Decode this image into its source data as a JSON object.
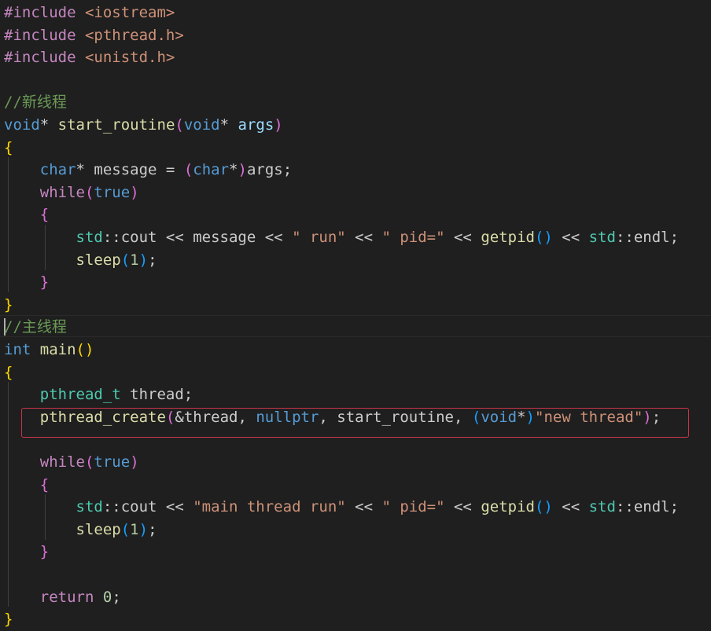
{
  "editor": {
    "language": "cpp",
    "colors": {
      "background": "#1f1f1f",
      "default": "#cccccc",
      "keyword": "#c586c0",
      "type": "#569cd6",
      "function": "#dcdcaa",
      "variable": "#9cdcfe",
      "namespace": "#4ec9b0",
      "string": "#ce9178",
      "number": "#b5cea8",
      "comment": "#6a9955",
      "bracket_gold": "#ffd700",
      "bracket_pink": "#da70d6",
      "bracket_blue": "#179fff",
      "highlight_box": "#c8354a"
    },
    "lines": [
      [
        [
          "#include",
          "keyword"
        ],
        [
          " ",
          "default"
        ],
        [
          "<iostream>",
          "string"
        ]
      ],
      [
        [
          "#include",
          "keyword"
        ],
        [
          " ",
          "default"
        ],
        [
          "<pthread.h>",
          "string"
        ]
      ],
      [
        [
          "#include",
          "keyword"
        ],
        [
          " ",
          "default"
        ],
        [
          "<unistd.h>",
          "string"
        ]
      ],
      [],
      [
        [
          "//新线程",
          "comment"
        ]
      ],
      [
        [
          "void",
          "type"
        ],
        [
          "*",
          "default"
        ],
        [
          " ",
          "default"
        ],
        [
          "start_routine",
          "function"
        ],
        [
          "(",
          "bracket_pink"
        ],
        [
          "void",
          "type"
        ],
        [
          "*",
          "default"
        ],
        [
          " ",
          "default"
        ],
        [
          "args",
          "variable"
        ],
        [
          ")",
          "bracket_pink"
        ]
      ],
      [
        [
          "{",
          "bracket_gold"
        ]
      ],
      [
        [
          "    ",
          "default"
        ],
        [
          "char",
          "type"
        ],
        [
          "* message = ",
          "default"
        ],
        [
          "(",
          "bracket_pink"
        ],
        [
          "char",
          "type"
        ],
        [
          "*",
          "default"
        ],
        [
          ")",
          "bracket_pink"
        ],
        [
          "args;",
          "default"
        ]
      ],
      [
        [
          "    ",
          "default"
        ],
        [
          "while",
          "keyword"
        ],
        [
          "(",
          "bracket_pink"
        ],
        [
          "true",
          "type"
        ],
        [
          ")",
          "bracket_pink"
        ]
      ],
      [
        [
          "    ",
          "default"
        ],
        [
          "{",
          "bracket_pink"
        ]
      ],
      [
        [
          "        ",
          "default"
        ],
        [
          "std",
          "namespace"
        ],
        [
          "::cout << message << ",
          "default"
        ],
        [
          "\" run\"",
          "string"
        ],
        [
          " << ",
          "default"
        ],
        [
          "\" pid=\"",
          "string"
        ],
        [
          " << ",
          "default"
        ],
        [
          "getpid",
          "function"
        ],
        [
          "()",
          "bracket_blue"
        ],
        [
          " << ",
          "default"
        ],
        [
          "std",
          "namespace"
        ],
        [
          "::endl;",
          "default"
        ]
      ],
      [
        [
          "        ",
          "default"
        ],
        [
          "sleep",
          "function"
        ],
        [
          "(",
          "bracket_blue"
        ],
        [
          "1",
          "number"
        ],
        [
          ")",
          "bracket_blue"
        ],
        [
          ";",
          "default"
        ]
      ],
      [
        [
          "    ",
          "default"
        ],
        [
          "}",
          "bracket_pink"
        ]
      ],
      [
        [
          "}",
          "bracket_gold"
        ]
      ],
      [
        [
          "//主线程",
          "comment"
        ]
      ],
      [
        [
          "int",
          "type"
        ],
        [
          " ",
          "default"
        ],
        [
          "main",
          "function"
        ],
        [
          "()",
          "bracket_gold"
        ]
      ],
      [
        [
          "{",
          "bracket_gold"
        ]
      ],
      [
        [
          "    ",
          "default"
        ],
        [
          "pthread_t",
          "namespace"
        ],
        [
          " thread;",
          "default"
        ]
      ],
      [
        [
          "    ",
          "default"
        ],
        [
          "pthread_create",
          "function"
        ],
        [
          "(",
          "bracket_pink"
        ],
        [
          "&thread, ",
          "default"
        ],
        [
          "nullptr",
          "type"
        ],
        [
          ", start_routine, ",
          "default"
        ],
        [
          "(",
          "bracket_blue"
        ],
        [
          "void",
          "type"
        ],
        [
          "*",
          "default"
        ],
        [
          ")",
          "bracket_blue"
        ],
        [
          "\"new thread\"",
          "string"
        ],
        [
          ")",
          "bracket_pink"
        ],
        [
          ";",
          "default"
        ]
      ],
      [],
      [
        [
          "    ",
          "default"
        ],
        [
          "while",
          "keyword"
        ],
        [
          "(",
          "bracket_pink"
        ],
        [
          "true",
          "type"
        ],
        [
          ")",
          "bracket_pink"
        ]
      ],
      [
        [
          "    ",
          "default"
        ],
        [
          "{",
          "bracket_pink"
        ]
      ],
      [
        [
          "        ",
          "default"
        ],
        [
          "std",
          "namespace"
        ],
        [
          "::cout << ",
          "default"
        ],
        [
          "\"main thread run\"",
          "string"
        ],
        [
          " << ",
          "default"
        ],
        [
          "\" pid=\"",
          "string"
        ],
        [
          " << ",
          "default"
        ],
        [
          "getpid",
          "function"
        ],
        [
          "()",
          "bracket_blue"
        ],
        [
          " << ",
          "default"
        ],
        [
          "std",
          "namespace"
        ],
        [
          "::endl;",
          "default"
        ]
      ],
      [
        [
          "        ",
          "default"
        ],
        [
          "sleep",
          "function"
        ],
        [
          "(",
          "bracket_blue"
        ],
        [
          "1",
          "number"
        ],
        [
          ")",
          "bracket_blue"
        ],
        [
          ";",
          "default"
        ]
      ],
      [
        [
          "    ",
          "default"
        ],
        [
          "}",
          "bracket_pink"
        ]
      ],
      [],
      [
        [
          "    ",
          "default"
        ],
        [
          "return",
          "keyword"
        ],
        [
          " ",
          "default"
        ],
        [
          "0",
          "number"
        ],
        [
          ";",
          "default"
        ]
      ],
      [
        [
          "}",
          "bracket_gold"
        ]
      ]
    ]
  }
}
